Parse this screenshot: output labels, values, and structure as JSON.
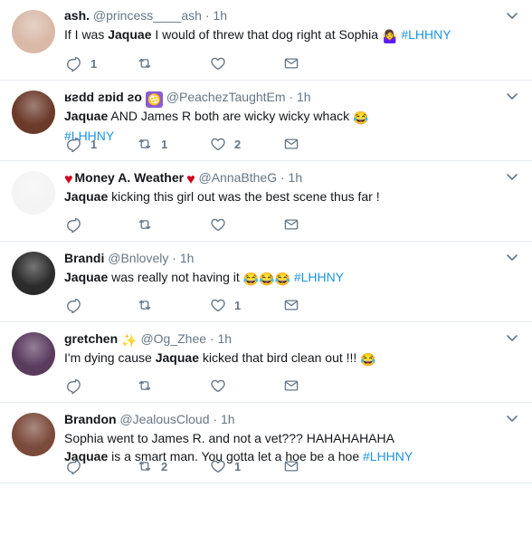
{
  "tweets": [
    {
      "name": "ash.",
      "handle": "@princess____ash",
      "dot": "·",
      "time": "1h",
      "lines": [
        [
          {
            "t": "If I was "
          },
          {
            "t": "Jaquae",
            "b": true
          },
          {
            "t": " I would of threw that dog right at Sophia "
          },
          {
            "emoji": "🤷‍♀️"
          },
          {
            "t": " "
          },
          {
            "t": "#LHHNY",
            "h": true
          }
        ]
      ],
      "reply_count": "1",
      "retweet_count": "",
      "like_count": "",
      "avatar_color": "#d9b9a8",
      "icon_names": [
        "reply-icon",
        "retweet-icon",
        "heart-icon",
        "envelope-icon"
      ]
    },
    {
      "name": "ʁƨdd ƨɒid ƨo",
      "name_emoji": "♋",
      "handle": "@PeachezTaughtEm",
      "dot": "·",
      "time": "1h",
      "lines": [
        [
          {
            "t": "Jaquae",
            "b": true
          },
          {
            "t": " AND James R both are wicky wicky whack "
          },
          {
            "emoji": "😂"
          }
        ],
        [
          {
            "t": "#LHHNY",
            "h": true
          }
        ]
      ],
      "reply_count": "1",
      "retweet_count": "1",
      "like_count": "2",
      "avatar_color": "#6b3a2a"
    },
    {
      "name": "Money A. Weather",
      "name_prefix_emoji": "♥",
      "name_suffix_emoji": "♥",
      "handle": "@AnnaBtheG",
      "dot": "·",
      "time": "1h",
      "lines": [
        [
          {
            "t": "Jaquae",
            "b": true
          },
          {
            "t": " kicking this girl out was the best scene thus far !"
          }
        ]
      ],
      "reply_count": "",
      "retweet_count": "",
      "like_count": "",
      "avatar_color": "#f4f4f4"
    },
    {
      "name": "Brandi",
      "handle": "@Bnlovely",
      "dot": "·",
      "time": "1h",
      "lines": [
        [
          {
            "t": "Jaquae",
            "b": true
          },
          {
            "t": " was really not having it "
          },
          {
            "emoji": "😂😂😂"
          },
          {
            "t": " "
          },
          {
            "t": "#LHHNY",
            "h": true
          }
        ]
      ],
      "reply_count": "",
      "retweet_count": "",
      "like_count": "1",
      "avatar_color": "#2b2b2b"
    },
    {
      "name": "gretchen",
      "name_emoji": "✨",
      "handle": "@Og_Zhee",
      "dot": "·",
      "time": "1h",
      "lines": [
        [
          {
            "t": "I'm dying cause "
          },
          {
            "t": "Jaquae",
            "b": true
          },
          {
            "t": " kicked that bird clean out !!! "
          },
          {
            "emoji": "😂"
          }
        ]
      ],
      "reply_count": "",
      "retweet_count": "",
      "like_count": "",
      "avatar_color": "#5a3b5e"
    },
    {
      "name": "Brandon",
      "handle": "@JealousCloud",
      "dot": "·",
      "time": "1h",
      "lines": [
        [
          {
            "t": "Sophia went to James R. and not a vet??? HAHAHAHAHA"
          }
        ],
        [
          {
            "t": "Jaquae",
            "b": true
          },
          {
            "t": " is a smart man. You gotta let a hoe be a hoe "
          },
          {
            "t": "#LHHNY",
            "h": true
          }
        ]
      ],
      "reply_count": "",
      "retweet_count": "2",
      "like_count": "1",
      "avatar_color": "#7a4a3a"
    }
  ],
  "colors": {
    "hashtag": "#1b95e0",
    "secondary_text": "#657786",
    "divider": "#e6ecf0",
    "emoji_heart": "#d0021b",
    "emoji_yellow": "#ffcc33",
    "emoji_purple": "#8a5cd6"
  }
}
